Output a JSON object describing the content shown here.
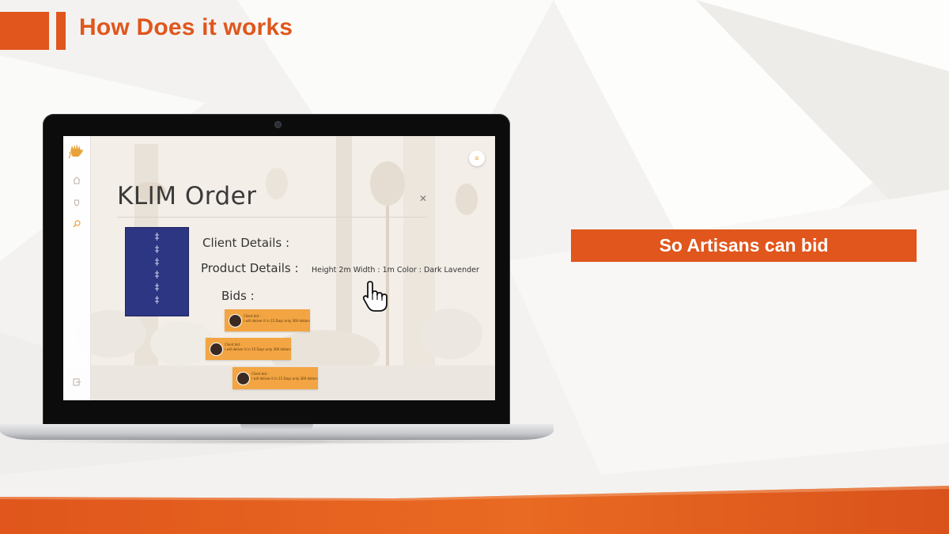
{
  "slide": {
    "title": "How Does it works",
    "callout": "So Artisans can bid",
    "accent_color": "#e0561c"
  },
  "app": {
    "sidebar_icons": [
      "logo-hand-icon",
      "home-icon",
      "pot-icon",
      "search-icon",
      "logout-icon"
    ],
    "menu_icon": "menu-icon",
    "order_title": "KLIM Order",
    "close_icon": "close-icon",
    "client_details_label": "Client Details :",
    "product_details_label": "Product Details :",
    "product_details_value": "Height 2m  Width : 1m Color : Dark Lavender",
    "bids_label": "Bids :",
    "bids": [
      {
        "name": "Client bid :",
        "text": "I will deliver it in 15 Days only 300 dollars"
      },
      {
        "name": "Client bid :",
        "text": "I will deliver it in 15 Days only 300 dollars"
      },
      {
        "name": "Client bid :",
        "text": "I will deliver it in 15 Days only 300 dollars"
      }
    ],
    "card_color": "#f2a542"
  }
}
